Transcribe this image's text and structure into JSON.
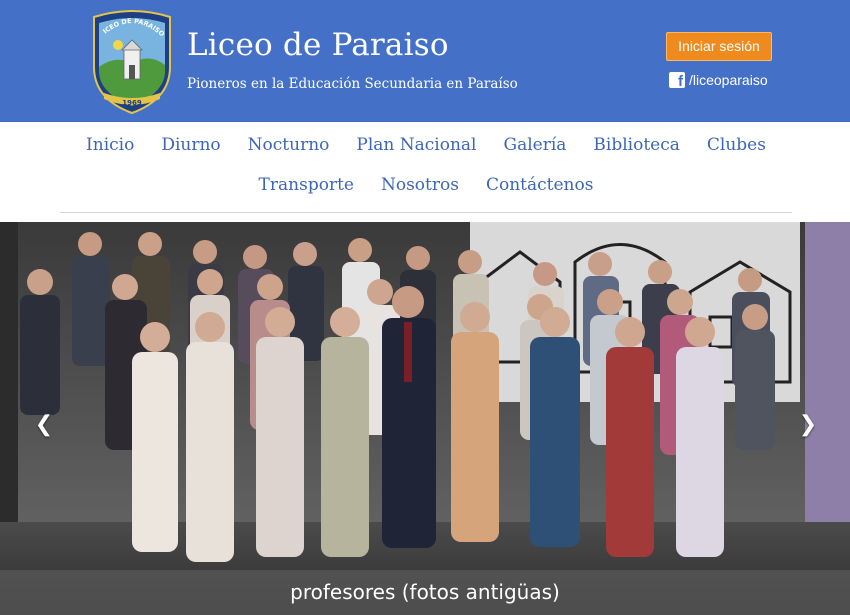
{
  "header": {
    "crest_text": "LICEO DE PARAISO",
    "crest_year": "1969",
    "title": "Liceo de Paraiso",
    "tagline": "Pioneros en la Educación Secundaria en Paraíso",
    "login_label": "Iniciar sesión",
    "facebook_label": "/liceoparaiso",
    "facebook_icon": "facebook-icon",
    "background_color": "#4471c7",
    "login_color": "#ef8a1e"
  },
  "nav": {
    "row1": [
      "Inicio",
      "Diurno",
      "Nocturno",
      "Plan Nacional",
      "Galería",
      "Biblioteca",
      "Clubes"
    ],
    "row2": [
      "Transporte",
      "Nosotros",
      "Contáctenos"
    ],
    "link_color": "#3d66b9"
  },
  "carousel": {
    "caption": "profesores (fotos antigüas)",
    "prev_label": "❮",
    "next_label": "❯"
  }
}
